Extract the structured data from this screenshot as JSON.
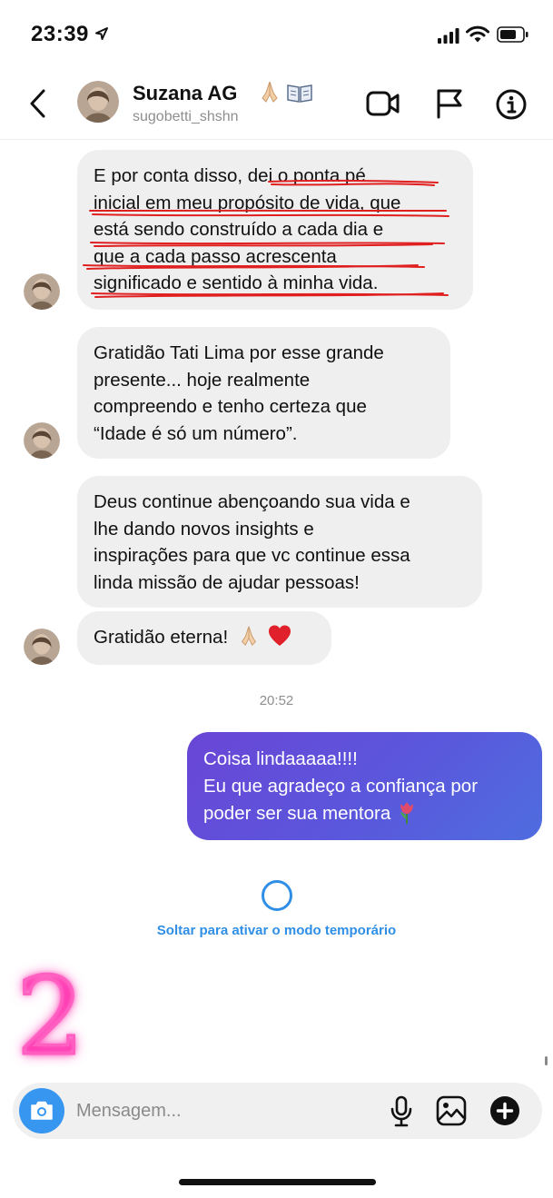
{
  "status_bar": {
    "time": "23:39",
    "icons": [
      "location-arrow-icon",
      "cellular-signal-icon",
      "wifi-icon",
      "battery-icon"
    ]
  },
  "header": {
    "name": "Suzana AG",
    "name_emoji_icons": [
      "praying-hands-icon",
      "open-book-icon"
    ],
    "username": "sugobetti_shshn",
    "actions": [
      "video-call-icon",
      "flag-icon",
      "info-icon"
    ]
  },
  "messages": [
    {
      "direction": "incoming",
      "lines": [
        "E por conta disso, dei o ponta pé",
        "inicial em meu propósito de vida, que",
        "está sendo construído a cada dia e",
        "que a cada passo acrescenta",
        "significado e sentido à minha vida."
      ],
      "annotation": "red-underline-handdrawn"
    },
    {
      "direction": "incoming",
      "lines": [
        "Gratidão Tati Lima por esse grande",
        "presente... hoje realmente",
        "compreendo e tenho certeza que",
        "“Idade é só um número”."
      ]
    },
    {
      "direction": "incoming",
      "lines": [
        "Deus continue abençoando sua vida e",
        "lhe dando novos insights e",
        "inspirações para que vc continue essa",
        "linda missão de ajudar pessoas!"
      ]
    },
    {
      "direction": "incoming",
      "lines": [
        "Gratidão eterna!"
      ],
      "emoji_icons": [
        "praying-hands-icon",
        "red-heart-icon"
      ]
    }
  ],
  "timestamp": "20:52",
  "outgoing": {
    "lines": [
      "Coisa lindaaaaa!!!!",
      "Eu que agradeço a confiança por",
      "poder ser sua mentora"
    ],
    "emoji_icon": "tulip-icon",
    "gradient_colors": [
      "#6a46d6",
      "#4f6ddf"
    ]
  },
  "vanish_mode": {
    "label": "Soltar para ativar o modo temporário",
    "color": "#2f8fe6"
  },
  "overlay": {
    "number": "2",
    "color": "#ff5fc0"
  },
  "composer": {
    "placeholder": "Mensagem...",
    "icons": [
      "camera-icon",
      "microphone-icon",
      "gallery-icon",
      "plus-icon"
    ],
    "camera_color": "#3797f0"
  }
}
